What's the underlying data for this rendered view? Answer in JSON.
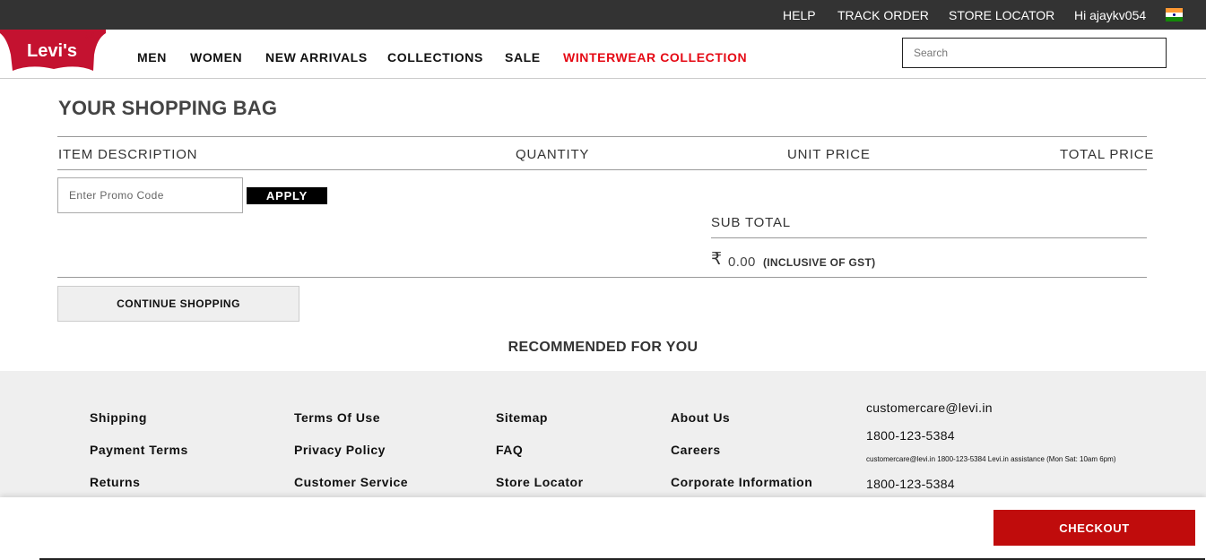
{
  "topbar": {
    "help": "HELP",
    "track_order": "TRACK ORDER",
    "store_locator": "STORE LOCATOR",
    "greeting": "Hi ajaykv054",
    "flag_icon": "india-flag-icon"
  },
  "brand": {
    "logo_text": "Levi's",
    "logo_registered": "®",
    "logo_color": "#c41230"
  },
  "nav": {
    "men": "MEN",
    "women": "WOMEN",
    "new_arrivals": "NEW ARRIVALS",
    "collections": "COLLECTIONS",
    "sale": "SALE",
    "winterwear": "WINTERWEAR COLLECTION",
    "winterwear_color": "#e50914"
  },
  "search": {
    "placeholder": "Search",
    "value": ""
  },
  "bag": {
    "title": "YOUR SHOPPING BAG",
    "columns": [
      "ITEM DESCRIPTION",
      "QUANTITY",
      "UNIT PRICE",
      "TOTAL PRICE"
    ],
    "promo_placeholder": "Enter Promo Code",
    "promo_value": "",
    "apply_label": "APPLY",
    "subtotal_label": "SUB TOTAL",
    "currency_symbol": "₹",
    "subtotal_amount": "0.00",
    "gst_note": "(INCLUSIVE OF GST)",
    "continue_label": "CONTINUE SHOPPING"
  },
  "recommended": {
    "title": "RECOMMENDED FOR YOU"
  },
  "footer": {
    "col1": [
      "Shipping",
      "Payment Terms",
      "Returns"
    ],
    "col2": [
      "Terms Of Use",
      "Privacy Policy",
      "Customer Service"
    ],
    "col3": [
      "Sitemap",
      "FAQ",
      "Store Locator"
    ],
    "col4": [
      "About Us",
      "Careers",
      "Corporate Information"
    ],
    "contact": {
      "email": "customercare@levi.in",
      "phone": "1800-123-5384",
      "assistance": "customercare@levi.in 1800-123-5384 Levi.in assistance (Mon Sat: 10am 6pm)",
      "phone_repeat": "1800-123-5384"
    }
  },
  "checkout": {
    "label": "CHECKOUT",
    "color": "#c00c0c"
  }
}
